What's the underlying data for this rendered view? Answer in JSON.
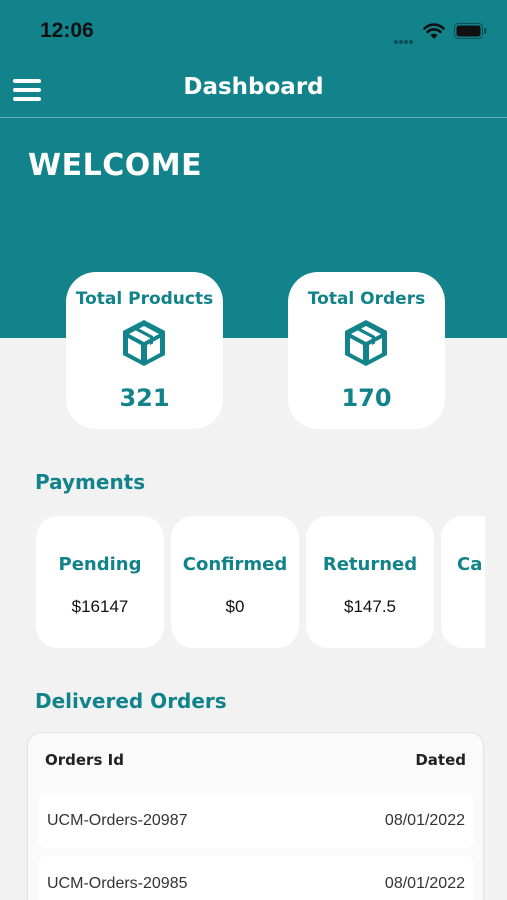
{
  "status_bar": {
    "time": "12:06"
  },
  "header": {
    "title": "Dashboard"
  },
  "welcome": "WELCOME",
  "stats": [
    {
      "label": "Total Products",
      "value": "321",
      "icon": "box-icon"
    },
    {
      "label": "Total Orders",
      "value": "170",
      "icon": "box-icon"
    }
  ],
  "payments": {
    "title": "Payments",
    "items": [
      {
        "label": "Pending",
        "value": "$16147"
      },
      {
        "label": "Confirmed",
        "value": "$0"
      },
      {
        "label": "Returned",
        "value": "$147.5"
      },
      {
        "label": "Ca",
        "value": ""
      }
    ]
  },
  "delivered_orders": {
    "title": "Delivered Orders",
    "columns": [
      "Orders Id",
      "Dated"
    ],
    "rows": [
      {
        "id": "UCM-Orders-20987",
        "date": "08/01/2022"
      },
      {
        "id": "UCM-Orders-20985",
        "date": "08/01/2022"
      }
    ]
  },
  "colors": {
    "primary": "#12838a",
    "background": "#f2f2f2",
    "card": "#ffffff"
  }
}
